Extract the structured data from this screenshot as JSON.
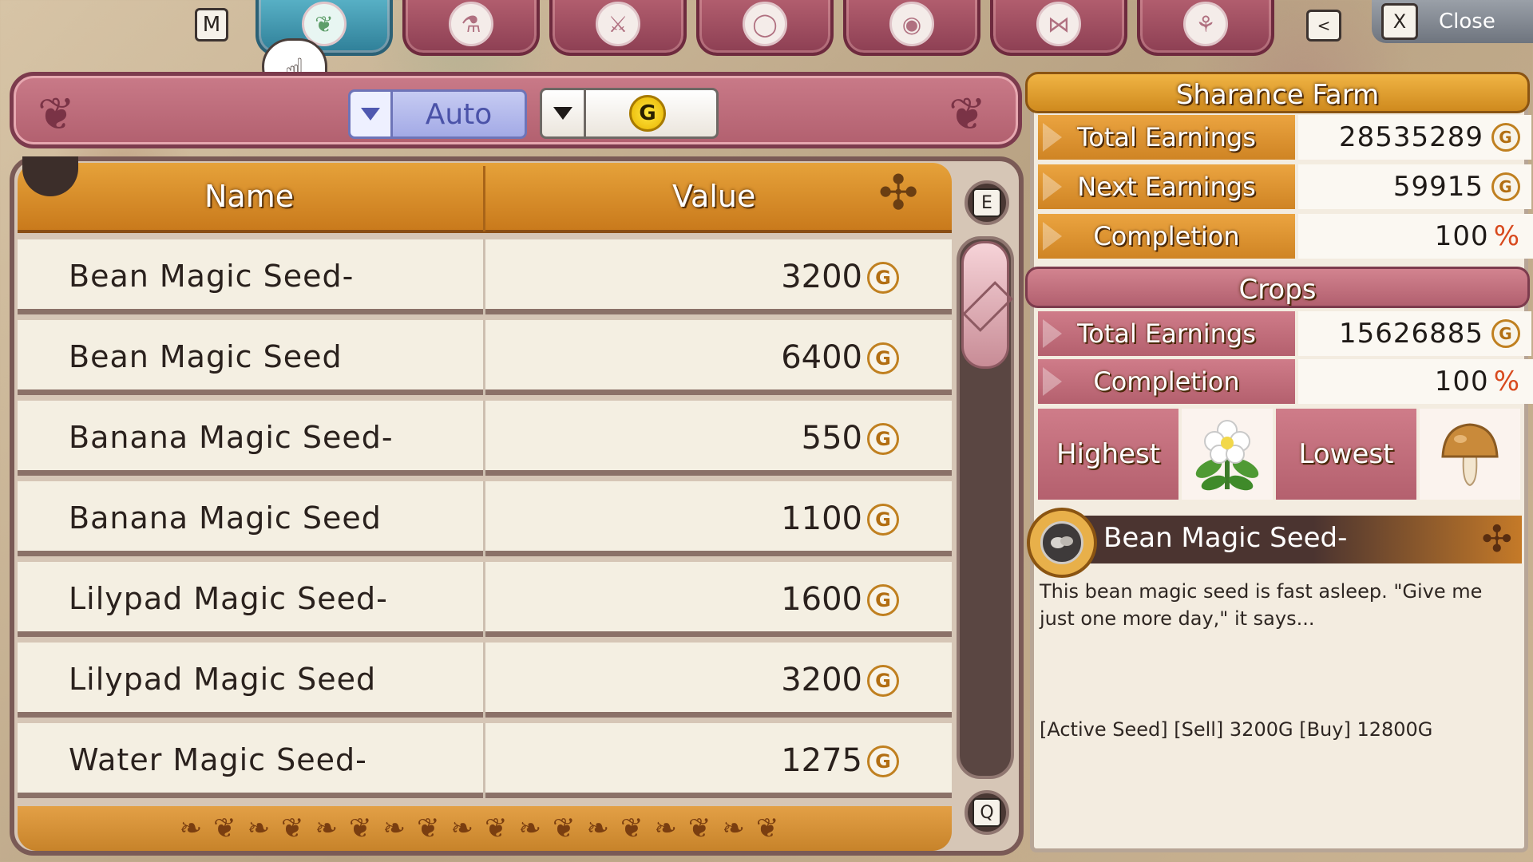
{
  "top_bar": {
    "key_m": "M",
    "key_back": "<",
    "key_close": "X",
    "close_label": "Close",
    "tabs": [
      {
        "name": "crops-tab",
        "icon": "turnip-icon",
        "glyph": "❦",
        "active": true
      },
      {
        "name": "potions-tab",
        "icon": "flask-icon",
        "glyph": "⚗",
        "active": false
      },
      {
        "name": "equipment-tab",
        "icon": "sword-shield-icon",
        "glyph": "⚔",
        "active": false
      },
      {
        "name": "accessory-tab",
        "icon": "ring-icon",
        "glyph": "◯",
        "active": false
      },
      {
        "name": "food-tab",
        "icon": "egg-icon",
        "glyph": "◉",
        "active": false
      },
      {
        "name": "fish-tab",
        "icon": "fish-icon",
        "glyph": "⋈",
        "active": false
      },
      {
        "name": "materials-tab",
        "icon": "branch-icon",
        "glyph": "⚘",
        "active": false
      }
    ]
  },
  "sort": {
    "mode_label": "Auto",
    "currency_label": "G"
  },
  "list": {
    "header_name": "Name",
    "header_value": "Value",
    "currency": "G",
    "rows": [
      {
        "name": "Bean Magic Seed-",
        "value": "3200"
      },
      {
        "name": "Bean Magic Seed",
        "value": "6400"
      },
      {
        "name": "Banana Magic Seed-",
        "value": "550"
      },
      {
        "name": "Banana Magic Seed",
        "value": "1100"
      },
      {
        "name": "Lilypad Magic Seed-",
        "value": "1600"
      },
      {
        "name": "Lilypad Magic Seed",
        "value": "3200"
      },
      {
        "name": "Water Magic Seed-",
        "value": "1275"
      }
    ],
    "key_e": "E",
    "key_q": "Q"
  },
  "farm": {
    "title": "Sharance Farm",
    "total_earnings_label": "Total Earnings",
    "total_earnings": "28535289",
    "next_earnings_label": "Next Earnings",
    "next_earnings": "59915",
    "completion_label": "Completion",
    "completion": "100",
    "pct": "%"
  },
  "crops": {
    "title": "Crops",
    "total_earnings_label": "Total Earnings",
    "total_earnings": "15626885",
    "completion_label": "Completion",
    "completion": "100",
    "pct": "%",
    "highest_label": "Highest",
    "highest_icon": "white-flower-icon",
    "lowest_label": "Lowest",
    "lowest_icon": "mushroom-icon"
  },
  "detail": {
    "title": "Bean Magic Seed-",
    "description": "This bean magic seed is fast asleep. \"Give me just one more day,\" it says...",
    "prices": "[Active Seed] [Sell] 3200G  [Buy] 12800G"
  },
  "colors": {
    "tab_active": "#2f7f98",
    "tab_inactive": "#8d3f53",
    "header_gold": "#c97a1c",
    "rose": "#b4606e",
    "percent": "#d84a1e"
  }
}
